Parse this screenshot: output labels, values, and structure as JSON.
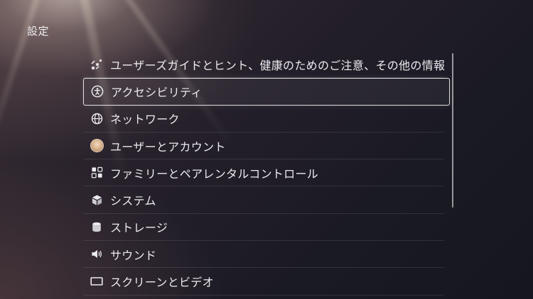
{
  "page": {
    "title": "設定"
  },
  "menu": {
    "items": [
      {
        "label": "ユーザーズガイドとヒント、健康のためのご注意、その他の情報",
        "icon": "guide-icon"
      },
      {
        "label": "アクセシビリティ",
        "icon": "accessibility-icon",
        "focused": true
      },
      {
        "label": "ネットワーク",
        "icon": "globe-icon"
      },
      {
        "label": "ユーザーとアカウント",
        "icon": "avatar-icon"
      },
      {
        "label": "ファミリーとペアレンタルコントロール",
        "icon": "family-icon"
      },
      {
        "label": "システム",
        "icon": "cube-icon"
      },
      {
        "label": "ストレージ",
        "icon": "storage-icon"
      },
      {
        "label": "サウンド",
        "icon": "speaker-icon"
      },
      {
        "label": "スクリーンとビデオ",
        "icon": "screen-icon"
      }
    ]
  },
  "colors": {
    "text": "#ecebee",
    "focus_border": "#ffffff",
    "background": "#1c1b25"
  }
}
